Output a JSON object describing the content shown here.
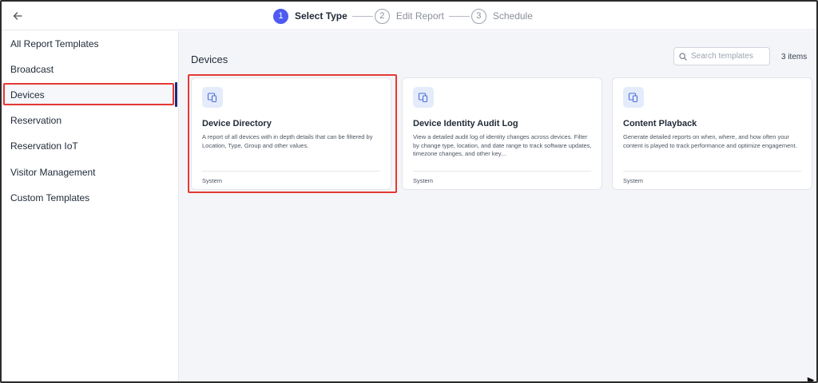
{
  "header": {
    "back_icon": "arrow-left-icon",
    "steps": [
      {
        "number": "1",
        "label": "Select Type",
        "active": true
      },
      {
        "number": "2",
        "label": "Edit Report",
        "active": false
      },
      {
        "number": "3",
        "label": "Schedule",
        "active": false
      }
    ]
  },
  "sidebar": {
    "items": [
      {
        "label": "All Report Templates"
      },
      {
        "label": "Broadcast"
      },
      {
        "label": "Devices",
        "selected": true
      },
      {
        "label": "Reservation"
      },
      {
        "label": "Reservation IoT"
      },
      {
        "label": "Visitor Management"
      },
      {
        "label": "Custom Templates"
      }
    ]
  },
  "main": {
    "section_title": "Devices",
    "search": {
      "placeholder": "Search templates",
      "value": "",
      "icon": "search-icon"
    },
    "items_count": "3 items",
    "cards": [
      {
        "icon": "devices-icon",
        "title": "Device Directory",
        "description": "A report of all devices with in depth details that can be filtered by Location, Type, Group and other values.",
        "footer": "System"
      },
      {
        "icon": "devices-icon",
        "title": "Device Identity Audit Log",
        "description": "View a detailed audit log of identity changes across devices. Filter by change type, location, and date range to track software updates, timezone changes, and other key...",
        "footer": "System"
      },
      {
        "icon": "devices-icon",
        "title": "Content Playback",
        "description": "Generate detailed reports on when, where, and how often your content is played to track performance and optimize engagement.",
        "footer": "System"
      }
    ]
  },
  "colors": {
    "accent": "#4f5bf0",
    "highlight": "#e53935",
    "active_bar": "#1e2a78",
    "main_bg": "#f4f5f9",
    "icon_bg": "#e4ecfb"
  }
}
